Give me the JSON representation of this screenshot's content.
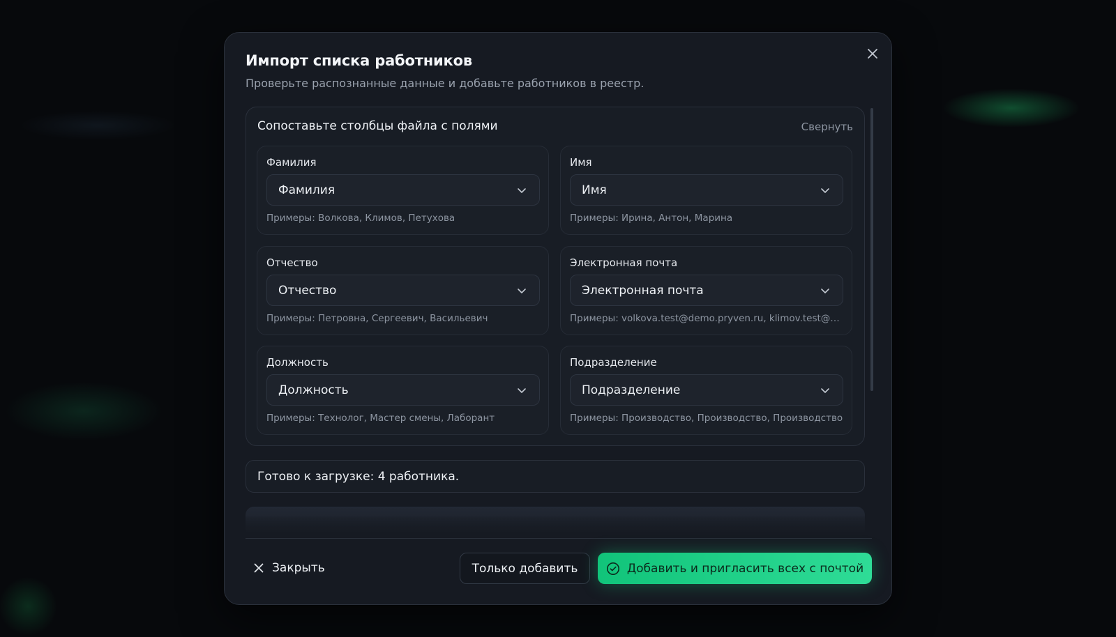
{
  "dialog": {
    "title": "Импорт списка работников",
    "subtitle": "Проверьте распознанные данные и добавьте работников в реестр."
  },
  "mapping": {
    "title": "Сопоставьте столбцы файла с полями",
    "collapse_label": "Свернуть",
    "fields": [
      {
        "label": "Фамилия",
        "selected": "Фамилия",
        "examples": "Примеры: Волкова, Климов, Петухова"
      },
      {
        "label": "Имя",
        "selected": "Имя",
        "examples": "Примеры: Ирина, Антон, Марина"
      },
      {
        "label": "Отчество",
        "selected": "Отчество",
        "examples": "Примеры: Петровна, Сергеевич, Васильевич"
      },
      {
        "label": "Электронная почта",
        "selected": "Электронная почта",
        "examples": "Примеры: volkova.test@demo.pryven.ru, klimov.test@demo.pryven.ru"
      },
      {
        "label": "Должность",
        "selected": "Должность",
        "examples": "Примеры: Технолог, Мастер смены, Лаборант"
      },
      {
        "label": "Подразделение",
        "selected": "Подразделение",
        "examples": "Примеры: Производство, Производство, Производство"
      }
    ]
  },
  "status": {
    "ready_text": "Готово к загрузке: 4 работника."
  },
  "footer": {
    "close_label": "Закрыть",
    "only_add_label": "Только добавить",
    "invite_label": "Добавить и пригласить всех с почтой"
  },
  "colors": {
    "accent": "#1fd089",
    "background": "#161a22"
  },
  "icons": {
    "close": "close-icon",
    "chevron": "chevron-down-icon",
    "check": "check-circle-icon"
  }
}
